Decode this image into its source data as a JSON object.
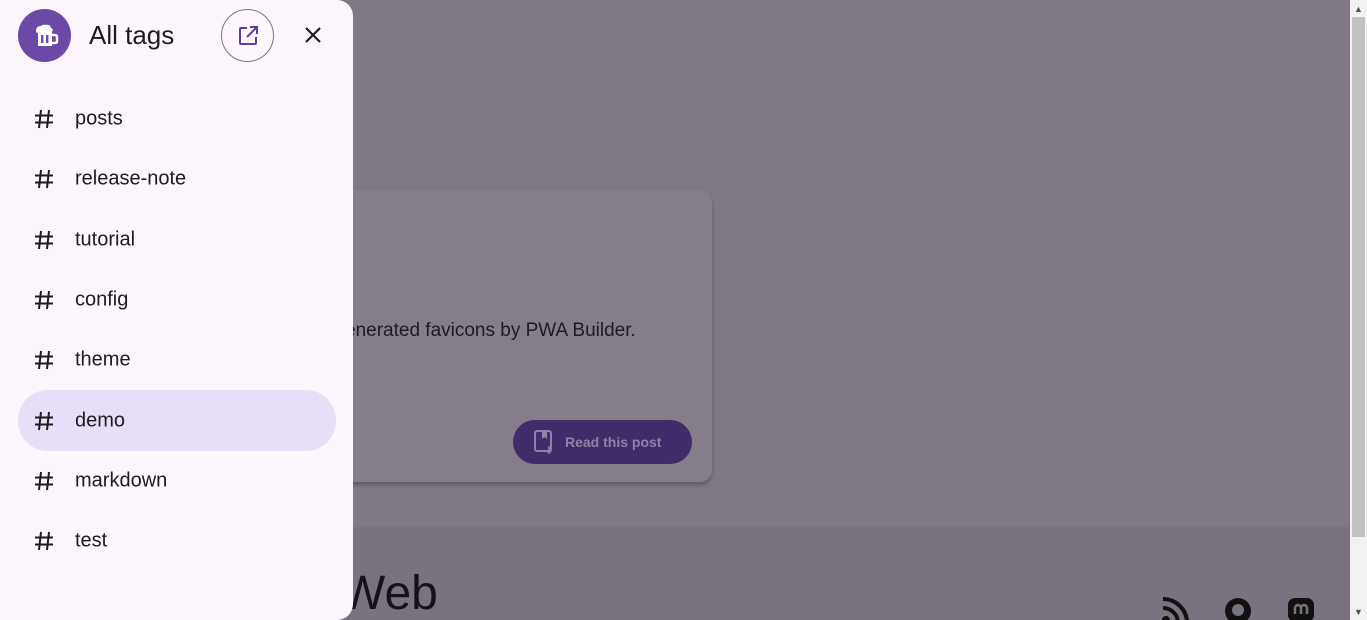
{
  "drawer": {
    "title": "All tags",
    "logo_icon": "beer-mug-icon",
    "open_icon": "open-in-new-icon",
    "close_icon": "close-icon",
    "tags": [
      {
        "label": "posts",
        "active": false
      },
      {
        "label": "release-note",
        "active": false
      },
      {
        "label": "tutorial",
        "active": false
      },
      {
        "label": "config",
        "active": false
      },
      {
        "label": "theme",
        "active": false
      },
      {
        "label": "demo",
        "active": true
      },
      {
        "label": "markdown",
        "active": false
      },
      {
        "label": "test",
        "active": false
      }
    ]
  },
  "background": {
    "card_description": "enerated favicons by PWA Builder.",
    "read_button_label": "Read this post",
    "footer_title": "Web",
    "footer_icons": [
      "rss-icon",
      "github-icon",
      "mastodon-icon"
    ]
  },
  "colors": {
    "accent": "#6a4aa6",
    "active_tag_bg": "#e8def8",
    "drawer_bg": "#fdf6fe"
  }
}
